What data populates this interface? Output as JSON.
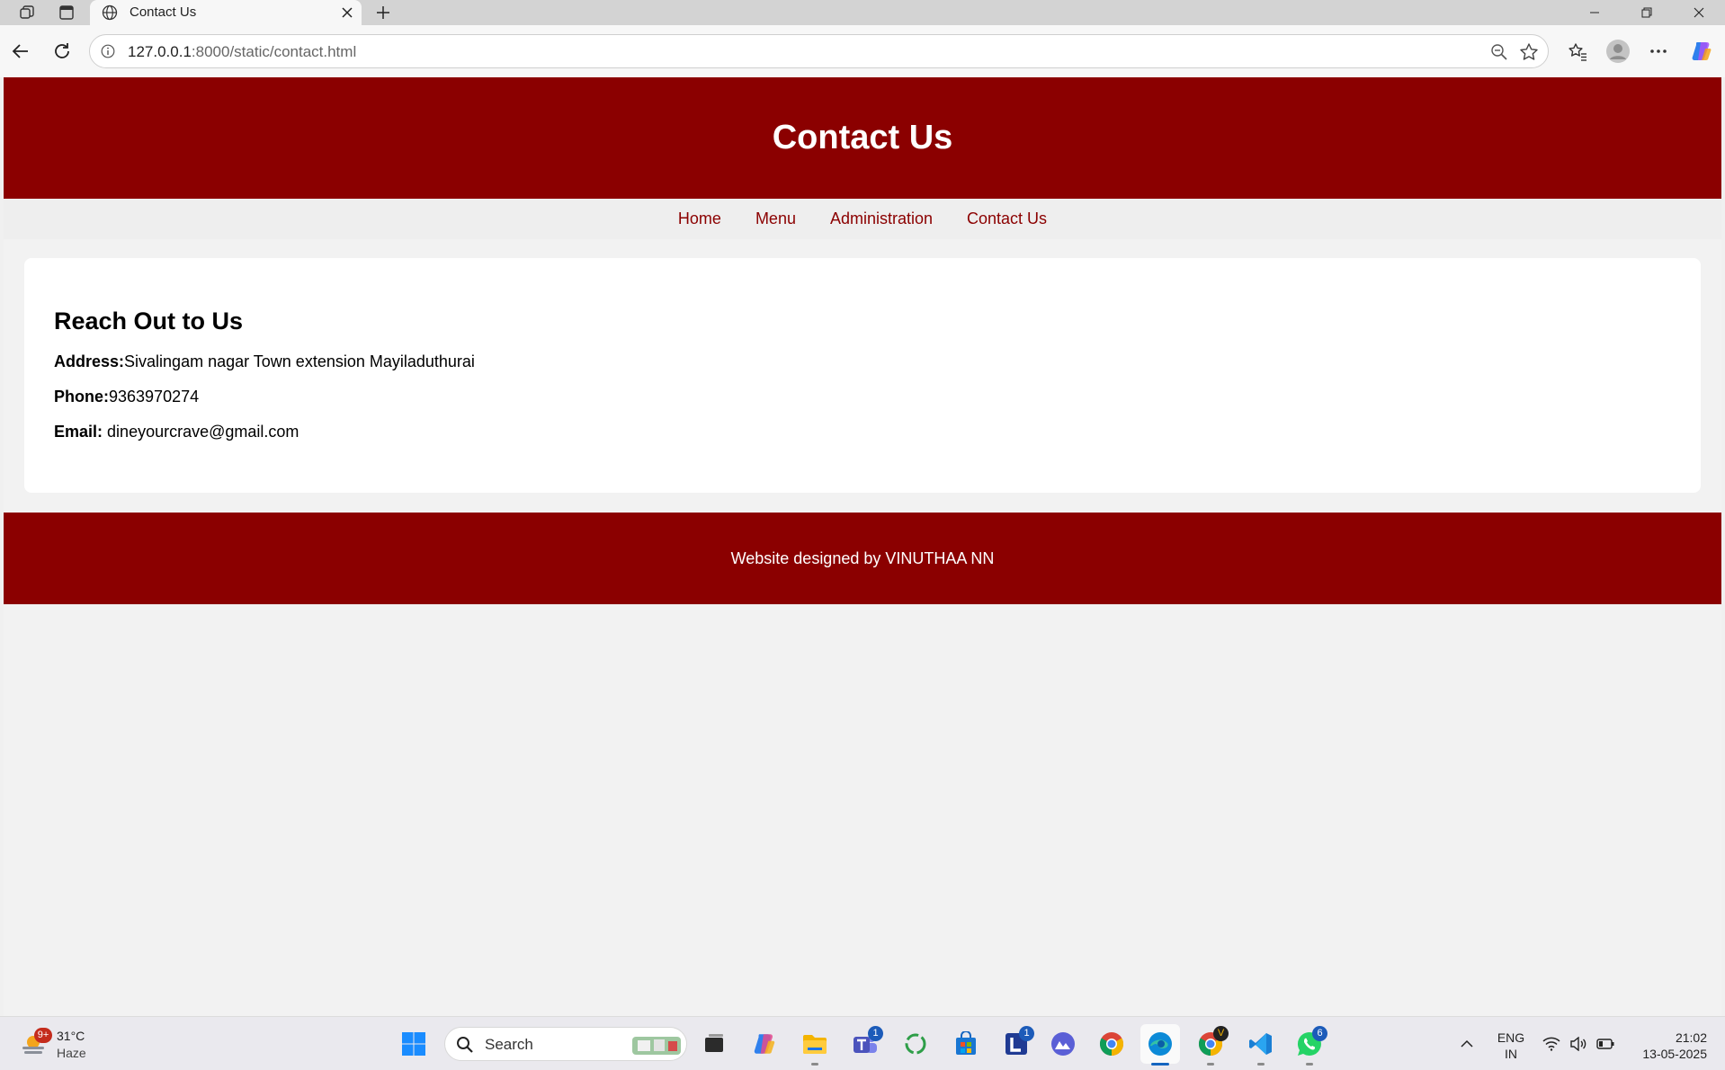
{
  "browser": {
    "tab_title": "Contact Us",
    "url_host": "127.0.0.1",
    "url_path": ":8000/static/contact.html"
  },
  "page": {
    "header_title": "Contact Us",
    "nav": [
      "Home",
      "Menu",
      "Administration",
      "Contact Us"
    ],
    "section_heading": "Reach Out to Us",
    "address_label": "Address:",
    "address_value": "Sivalingam nagar Town extension Mayiladuthurai",
    "phone_label": "Phone:",
    "phone_value": "9363970274",
    "email_label": "Email:",
    "email_value": "dineyourcrave@gmail.com",
    "footer_text": "Website designed by VINUTHAA NN",
    "colors": {
      "brand": "#8b0000",
      "background": "#f2f2f2",
      "card": "#ffffff"
    }
  },
  "taskbar": {
    "weather_temp": "31°C",
    "weather_condition": "Haze",
    "weather_badge": "9+",
    "search_placeholder": "Search",
    "teams_badge": "1",
    "l_app_badge": "1",
    "chrome_profile_badge": "V",
    "whatsapp_badge": "6",
    "lang_line1": "ENG",
    "lang_line2": "IN",
    "time": "21:02",
    "date": "13-05-2025"
  }
}
